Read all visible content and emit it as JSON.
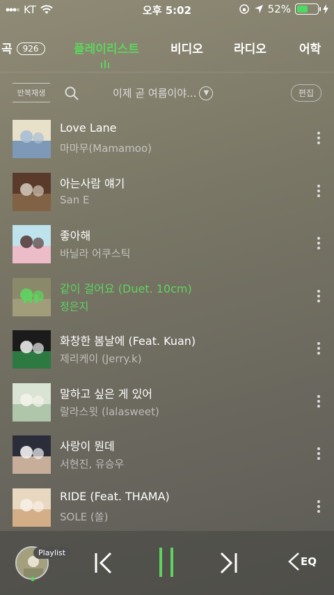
{
  "status_bar": {
    "carrier": "KT",
    "time": "오후 5:02",
    "battery": "52%",
    "battery_level": 0.52,
    "icons": [
      "signal-icon",
      "wifi-icon",
      "orientation-lock-icon",
      "location-icon",
      "battery-icon",
      "charging-icon"
    ]
  },
  "tabs": [
    {
      "label": "곡",
      "badge": "926"
    },
    {
      "label": "플레이리스트"
    },
    {
      "label": "비디오"
    },
    {
      "label": "라디오"
    },
    {
      "label": "어학"
    }
  ],
  "toolbar": {
    "repeat_label": "반복재생",
    "playlist_name": "이제 곧 여름이야...",
    "edit_label": "편집"
  },
  "songs": [
    {
      "title": "Love Lane",
      "artist": "마마무(Mamamoo)",
      "cover_colors": [
        "#e9e0c9",
        "#6b8bb5",
        "#a9bfd6"
      ]
    },
    {
      "title": "아는사람 얘기",
      "artist": "San E",
      "cover_colors": [
        "#5a3a2a",
        "#8a6a4a",
        "#cfc5b8"
      ]
    },
    {
      "title": "좋아해",
      "artist": "바닐라 어쿠스틱",
      "cover_colors": [
        "#bfe3ec",
        "#f3b6c2",
        "#5a3d3d"
      ]
    },
    {
      "title": "같이 걸어요 (Duet. 10cm)",
      "artist": "정은지",
      "cover_colors": [
        "#8a8a6a",
        "#a4a07e",
        "#5fd35f"
      ],
      "playing": true
    },
    {
      "title": "화창한 봄날에 (Feat. Kuan)",
      "artist": "제리케이 (Jerry.k)",
      "cover_colors": [
        "#1b1b1b",
        "#2f8a48",
        "#eaeaea"
      ]
    },
    {
      "title": "말하고 싶은 게 있어",
      "artist": "랄라스윗 (lalasweet)",
      "cover_colors": [
        "#d9e4d5",
        "#a8c1a3",
        "#f4f2ea"
      ]
    },
    {
      "title": "사랑이 뭔데",
      "artist": "서현진, 유승우",
      "cover_colors": [
        "#2b2d3a",
        "#e3c6ad",
        "#f2f2f2"
      ]
    },
    {
      "title": "RIDE (Feat. THAMA)",
      "artist": "SOLE (쏠)",
      "cover_colors": [
        "#e9d8c0",
        "#cfa77d",
        "#f6efe4"
      ]
    }
  ],
  "player": {
    "playlist_tag": "Playlist",
    "eq_label": "EQ"
  },
  "colors": {
    "accent": "#5fd35f",
    "text": "#ffffff",
    "muted": "rgba(255,255,255,0.55)"
  }
}
